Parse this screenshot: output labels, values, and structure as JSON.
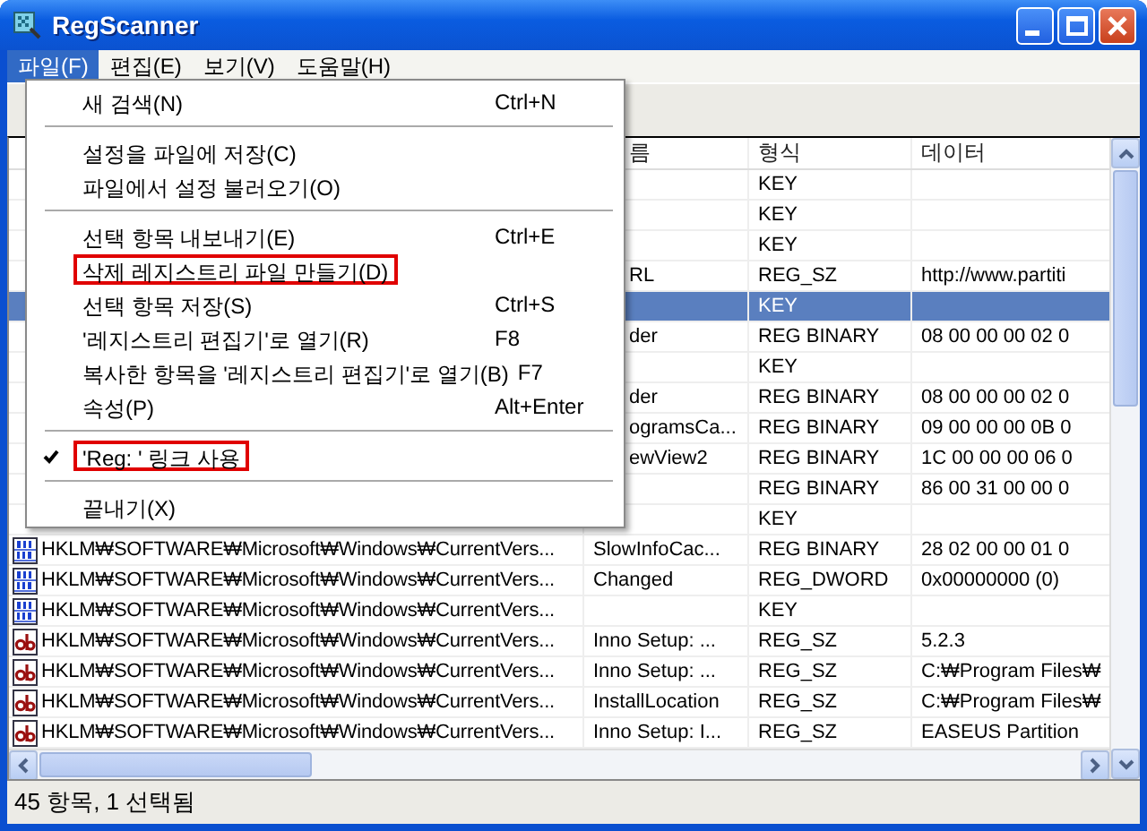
{
  "window": {
    "title": "RegScanner"
  },
  "menubar": [
    {
      "label": "파일(F)",
      "selected": true
    },
    {
      "label": "편집(E)",
      "selected": false
    },
    {
      "label": "보기(V)",
      "selected": false
    },
    {
      "label": "도움말(H)",
      "selected": false
    }
  ],
  "menu": [
    {
      "kind": "item",
      "label": "새 검색(N)",
      "shortcut": "Ctrl+N",
      "checked": false,
      "highlighted": false
    },
    {
      "kind": "separator"
    },
    {
      "kind": "item",
      "label": "설정을 파일에 저장(C)",
      "checked": false,
      "highlighted": false
    },
    {
      "kind": "item",
      "label": "파일에서 설정 불러오기(O)",
      "checked": false,
      "highlighted": false
    },
    {
      "kind": "separator"
    },
    {
      "kind": "item",
      "label": "선택 항목 내보내기(E)",
      "shortcut": "Ctrl+E",
      "checked": false,
      "highlighted": false
    },
    {
      "kind": "item",
      "label": "삭제 레지스트리 파일 만들기(D)",
      "checked": false,
      "highlighted": true
    },
    {
      "kind": "item",
      "label": "선택 항목 저장(S)",
      "shortcut": "Ctrl+S",
      "checked": false,
      "highlighted": false
    },
    {
      "kind": "item",
      "label": "'레지스트리 편집기'로 열기(R)",
      "shortcut": "F8",
      "checked": false,
      "highlighted": false
    },
    {
      "kind": "item",
      "label": "복사한 항목을 '레지스트리 편집기'로 열기(B)",
      "shortcut": "F7",
      "checked": false,
      "highlighted": false
    },
    {
      "kind": "item",
      "label": "속성(P)",
      "shortcut": "Alt+Enter",
      "checked": false,
      "highlighted": false
    },
    {
      "kind": "separator"
    },
    {
      "kind": "item",
      "label": "'Reg: ' 링크 사용",
      "checked": true,
      "highlighted": true
    },
    {
      "kind": "separator"
    },
    {
      "kind": "item",
      "label": "끝내기(X)",
      "checked": false,
      "highlighted": false
    }
  ],
  "table": {
    "columns": [
      "름",
      "형식",
      "데이터"
    ],
    "rows": [
      {
        "selected": false,
        "type": "KEY"
      },
      {
        "selected": false,
        "type": "KEY"
      },
      {
        "selected": false,
        "type": "KEY"
      },
      {
        "selected": false,
        "name": "RL",
        "type": "REG_SZ",
        "data": "http://www.partiti"
      },
      {
        "selected": true,
        "type": "KEY"
      },
      {
        "selected": false,
        "name": "der",
        "type": "REG BINARY",
        "data": "08 00 00 00 02 0"
      },
      {
        "selected": false,
        "type": "KEY"
      },
      {
        "selected": false,
        "name": "der",
        "type": "REG BINARY",
        "data": "08 00 00 00 02 0"
      },
      {
        "selected": false,
        "name": "ogramsCa...",
        "type": "REG BINARY",
        "data": "09 00 00 00 0B 0"
      },
      {
        "selected": false,
        "name": "ewView2",
        "type": "REG BINARY",
        "data": "1C 00 00 00 06 0"
      },
      {
        "selected": false,
        "type": "REG BINARY",
        "data": "86 00 31 00 00 0"
      },
      {
        "selected": false,
        "type": "KEY"
      },
      {
        "selected": false,
        "kind": "binary",
        "path": "HKLM₩SOFTWARE₩Microsoft₩Windows₩CurrentVers...",
        "name": "SlowInfoCac...",
        "type": "REG BINARY",
        "data": "28 02 00 00 01 0"
      },
      {
        "selected": false,
        "kind": "binary",
        "path": "HKLM₩SOFTWARE₩Microsoft₩Windows₩CurrentVers...",
        "name": "Changed",
        "type": "REG_DWORD",
        "data": "0x00000000 (0)"
      },
      {
        "selected": false,
        "kind": "binary",
        "path": "HKLM₩SOFTWARE₩Microsoft₩Windows₩CurrentVers...",
        "type": "KEY"
      },
      {
        "selected": false,
        "kind": "string",
        "path": "HKLM₩SOFTWARE₩Microsoft₩Windows₩CurrentVers...",
        "name": "Inno Setup: ...",
        "type": "REG_SZ",
        "data": "5.2.3"
      },
      {
        "selected": false,
        "kind": "string",
        "path": "HKLM₩SOFTWARE₩Microsoft₩Windows₩CurrentVers...",
        "name": "Inno Setup: ...",
        "type": "REG_SZ",
        "data": "C:₩Program Files₩"
      },
      {
        "selected": false,
        "kind": "string",
        "path": "HKLM₩SOFTWARE₩Microsoft₩Windows₩CurrentVers...",
        "name": "InstallLocation",
        "type": "REG_SZ",
        "data": "C:₩Program Files₩"
      },
      {
        "selected": false,
        "kind": "string",
        "path": "HKLM₩SOFTWARE₩Microsoft₩Windows₩CurrentVers...",
        "name": "Inno Setup: I...",
        "type": "REG_SZ",
        "data": "EASEUS Partition"
      }
    ]
  },
  "status_bar": "45 항목, 1 선택됨"
}
